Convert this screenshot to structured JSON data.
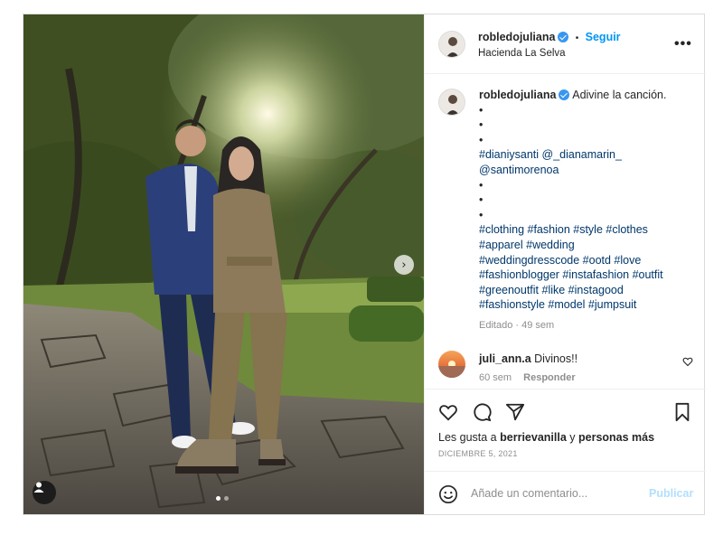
{
  "post": {
    "author": "robledojuliana",
    "follow_label": "Seguir",
    "separator": "•",
    "location": "Hacienda La Selva",
    "more_label": "•••",
    "next_icon": "chevron-right-icon",
    "tag_icon": "person-tag-icon",
    "carousel_count": 2,
    "carousel_active": 0
  },
  "caption": {
    "author": "robledojuliana",
    "text": "Adivine la canción.",
    "dots_top": [
      "•",
      "•",
      "•"
    ],
    "tag_line1": "#dianiysanti",
    "mention1": "@_dianamarin_",
    "mention2": "@santimorenoa",
    "dots_mid": [
      "•",
      "•",
      "•"
    ],
    "hashtags": [
      "#clothing #fashion #style #clothes",
      "#apparel #wedding",
      "#weddingdresscode #ootd #love",
      "#fashionblogger #instafashion #outfit",
      "#greenoutfit #like #instagood",
      "#fashionstyle #model #jumpsuit"
    ],
    "edited": "Editado",
    "meta_sep": "·",
    "time": "49 sem"
  },
  "comment": {
    "author": "juli_ann.a",
    "text": "Divinos!!",
    "time": "60 sem",
    "reply": "Responder"
  },
  "likes": {
    "prefix": "Les gusta a",
    "user": "berrievanilla",
    "connector": "y",
    "others": "personas más"
  },
  "date": "DICIEMBRE 5, 2021",
  "add_comment": {
    "placeholder": "Añade un comentario...",
    "publish": "Publicar"
  },
  "colors": {
    "accent": "#0095f6",
    "hashtag": "#00376b",
    "muted": "#8e8e8e",
    "publish_disabled": "#b2dffc"
  }
}
